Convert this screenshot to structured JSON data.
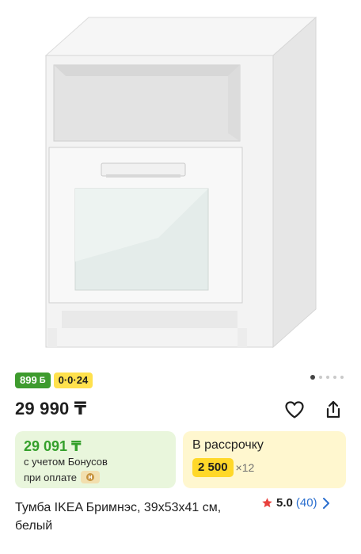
{
  "product": {
    "image_alt": "IKEA Brimnes bedside table, white",
    "badges": {
      "bonus_amount": "899",
      "bonus_symbol": "Б",
      "installment": "0·0·24"
    },
    "price": "29 990 ₸",
    "bonus_card": {
      "price": "29 091 ₸",
      "note_line1": "с учетом Бонусов",
      "note_line2": "при оплате"
    },
    "installment_card": {
      "title": "В рассрочку",
      "amount": "2 500",
      "multiplier": "×12"
    },
    "title": "Тумба IKEA Бримнэс, 39x53x41 см, белый",
    "rating": {
      "score": "5.0",
      "reviews": "(40)"
    }
  },
  "colors": {
    "bonus_green": "#3e9b2e",
    "bonus_price_green": "#35a02c",
    "bonus_card_bg": "#e9f6dc",
    "installment_yellow": "#ffe14d",
    "installment_card_bg": "#fff7cf",
    "rating_star": "#e8413d",
    "link_blue": "#2b6fcf"
  },
  "icons": [
    "heart-icon",
    "share-icon",
    "star-icon",
    "chevron-right-icon",
    "bonus-payment-icon"
  ],
  "carousel": {
    "total_dots": 5,
    "active_index": 0
  }
}
